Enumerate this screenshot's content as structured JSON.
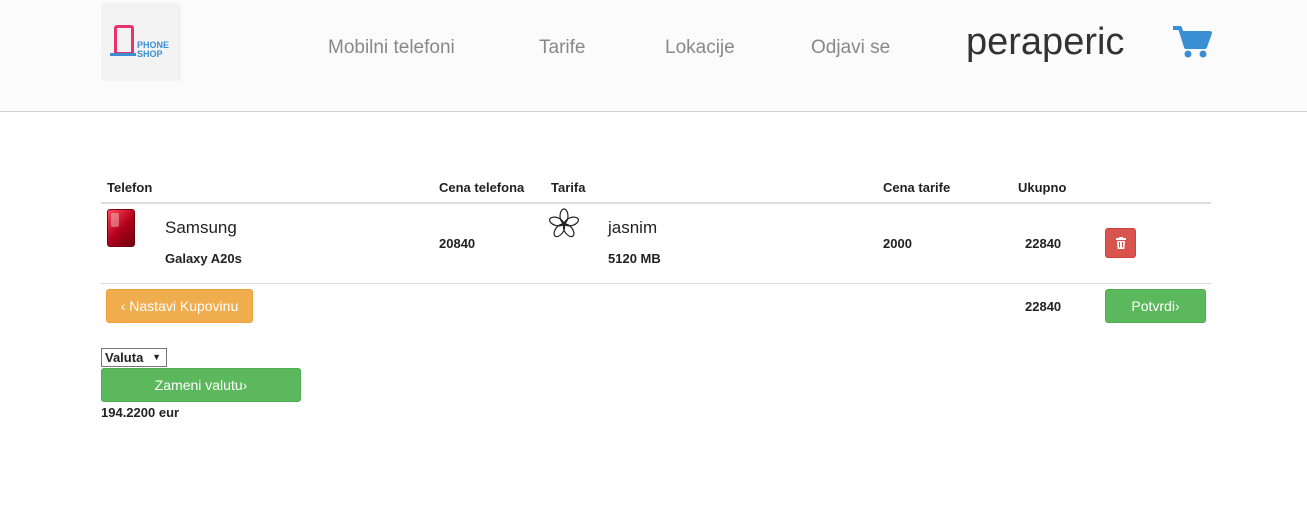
{
  "header": {
    "logo_text_line1": "PHONE",
    "logo_text_line2": "SHOP",
    "nav": [
      "Mobilni telefoni",
      "Tarife",
      "Lokacije",
      "Odjavi se"
    ],
    "username": "peraperic",
    "cart_icon": "shopping-cart-icon",
    "cart_color": "#3a8fd4"
  },
  "table": {
    "headers": {
      "phone": "Telefon",
      "phone_price": "Cena telefona",
      "plan": "Tarifa",
      "plan_price": "Cena tarife",
      "total": "Ukupno"
    },
    "rows": [
      {
        "brand": "Samsung",
        "model": "Galaxy A20s",
        "phone_price": "20840",
        "plan_name": "jasnim",
        "plan_data": "5120 MB",
        "plan_price": "2000",
        "total": "22840",
        "plan_icon": "flower-icon",
        "delete_icon": "trash-icon"
      }
    ],
    "grand_total": "22840"
  },
  "actions": {
    "continue_label": "‹ Nastavi Kupovinu",
    "confirm_label": "Potvrdi›"
  },
  "currency": {
    "select_value": "Valuta",
    "convert_label": "Zameni valutu›",
    "converted_amount": "194.2200 eur"
  },
  "colors": {
    "danger": "#d9534f",
    "warning": "#f0ad4e",
    "success": "#5cb85c"
  }
}
